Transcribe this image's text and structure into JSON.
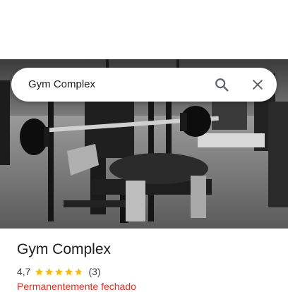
{
  "search": {
    "query": "Gym Complex"
  },
  "place": {
    "name": "Gym Complex",
    "rating": "4,7",
    "rating_value": 4.7,
    "review_count": "(3)",
    "status": "Permanentemente fechado"
  },
  "icons": {
    "search": "search-icon",
    "close": "close-icon",
    "star": "star-icon"
  },
  "colors": {
    "star": "#fbbc04",
    "status": "#d93025",
    "text": "#202124"
  }
}
